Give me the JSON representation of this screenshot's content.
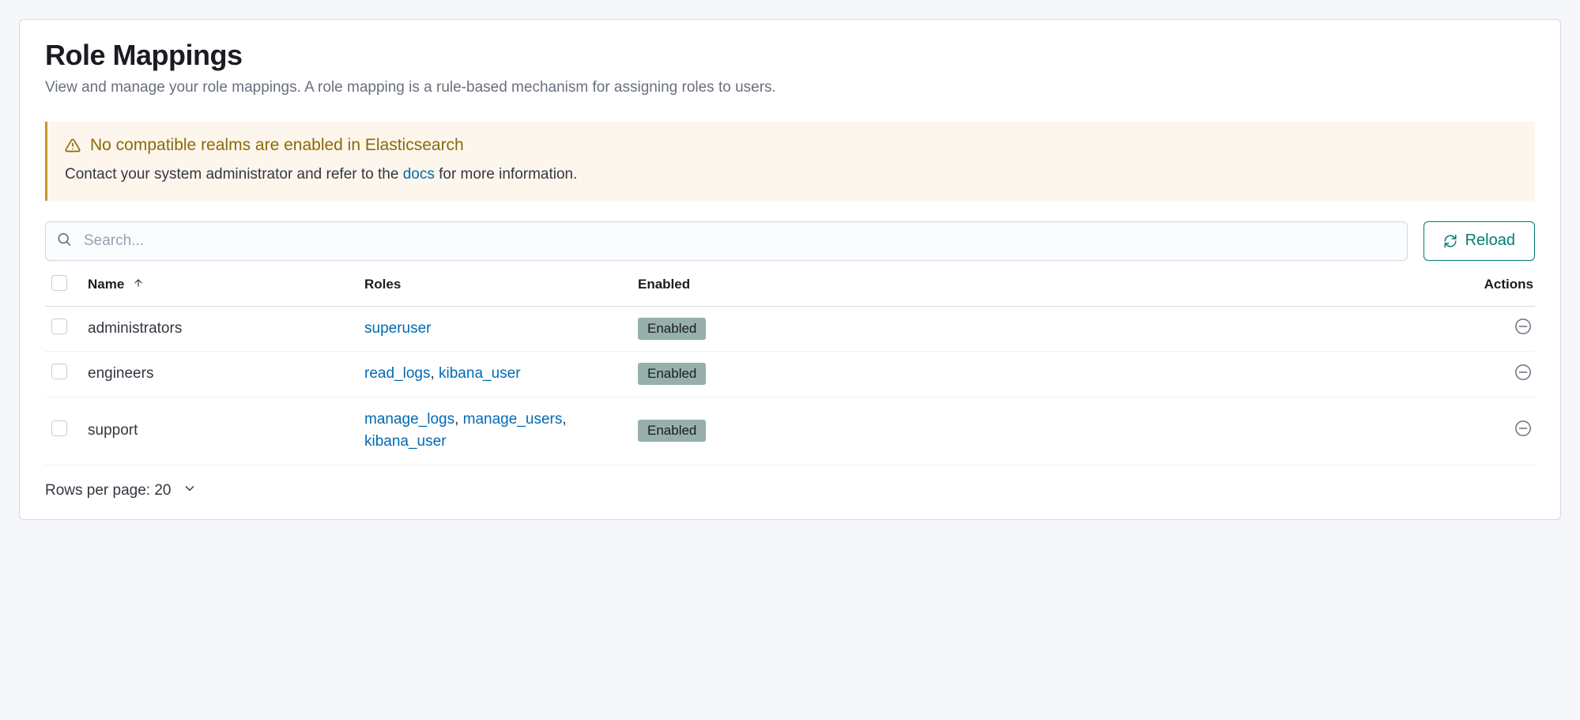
{
  "header": {
    "title": "Role Mappings",
    "subtitle": "View and manage your role mappings. A role mapping is a rule-based mechanism for assigning roles to users."
  },
  "callout": {
    "title": "No compatible realms are enabled in Elasticsearch",
    "body_pre": "Contact your system administrator and refer to the ",
    "docs_label": "docs",
    "body_post": " for more information."
  },
  "search": {
    "placeholder": "Search..."
  },
  "toolbar": {
    "reload_label": "Reload"
  },
  "columns": {
    "name": "Name",
    "roles": "Roles",
    "enabled": "Enabled",
    "actions": "Actions"
  },
  "enabled_badge_label": "Enabled",
  "rows": [
    {
      "name": "administrators",
      "roles": [
        "superuser"
      ],
      "enabled": true
    },
    {
      "name": "engineers",
      "roles": [
        "read_logs",
        "kibana_user"
      ],
      "enabled": true
    },
    {
      "name": "support",
      "roles": [
        "manage_logs",
        "manage_users",
        "kibana_user"
      ],
      "enabled": true
    }
  ],
  "pagination": {
    "rows_per_page_label": "Rows per page: 20"
  }
}
